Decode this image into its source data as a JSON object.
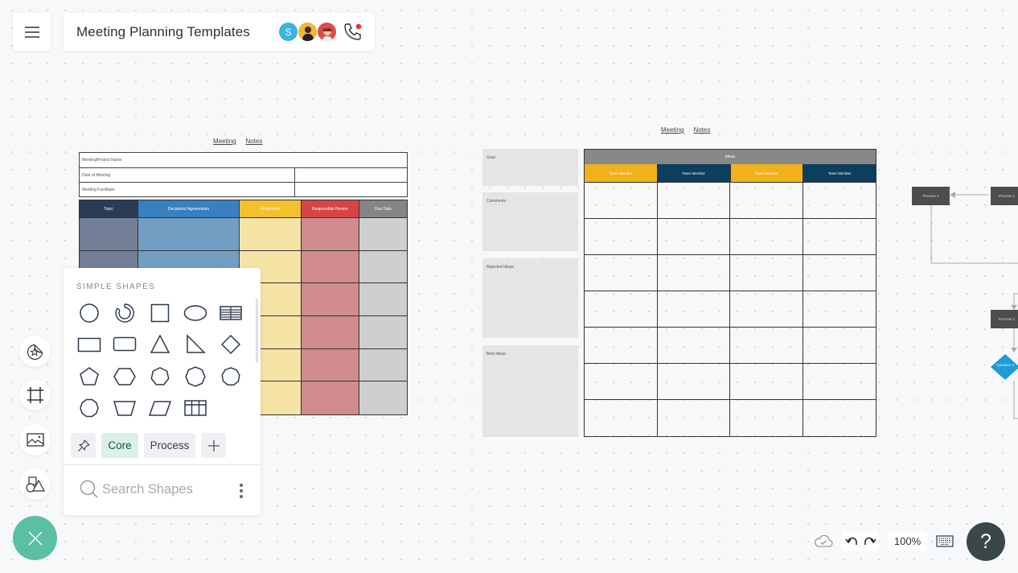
{
  "header": {
    "menu_icon": "hamburger-menu-icon",
    "title": "Meeting Planning Templates",
    "collaborators": [
      {
        "initial": "S",
        "color": "#3fb3df"
      },
      {
        "initial": "",
        "color": "#f2b632"
      },
      {
        "initial": "",
        "color": "#e24a4a"
      }
    ],
    "call_icon": "phone-icon",
    "call_indicator_color": "#e5383b"
  },
  "template_left": {
    "title_words": [
      "Meeting",
      "Notes"
    ],
    "info_rows": [
      "Meeting/Project     Name",
      "Date   of  Meeting",
      "Meeting    Facilitator"
    ],
    "columns": [
      {
        "label": "Topic",
        "header_color": "#2b3a55",
        "cell_color": "#737f96"
      },
      {
        "label": "Decisions/    Agreements",
        "header_color": "#3a7fc0",
        "cell_color": "#739ec4"
      },
      {
        "label": "Action    Item",
        "header_color": "#f2c12e",
        "cell_color": "#f6e3a6"
      },
      {
        "label": "Responsible    Person",
        "header_color": "#d64545",
        "cell_color": "#cf8b8e"
      },
      {
        "label": "Due  Date",
        "header_color": "#858585",
        "cell_color": "#cfcfcf"
      }
    ],
    "body_rows": 6
  },
  "template_right": {
    "title_words": [
      "Meeting",
      "Notes"
    ],
    "side_boxes": [
      "Goal:",
      "Comments",
      "Rejected    Ideas:",
      "Best   Ideas:"
    ],
    "ideas_header": "Ideas",
    "members": [
      {
        "label": "Team   Member",
        "color": "#f0b11c"
      },
      {
        "label": "Team   Member",
        "color": "#0c3e5e"
      },
      {
        "label": "Team   Member",
        "color": "#f0b11c"
      },
      {
        "label": "Team   Member",
        "color": "#0c3e5e"
      }
    ],
    "body_rows": 7
  },
  "flowchart": {
    "nodes": [
      "Process   2",
      "Process   1",
      "Process   3"
    ],
    "decision": "Question 4",
    "decision_color": "#1e9ad6"
  },
  "shape_panel": {
    "heading": "SIMPLE SHAPES",
    "shapes": [
      "circle",
      "donut",
      "square",
      "ellipse",
      "table",
      "rectangle",
      "rounded-rectangle",
      "triangle",
      "right-triangle",
      "diamond",
      "pentagon",
      "hexagon",
      "heptagon",
      "octagon",
      "nonagon",
      "decagon",
      "trapezoid",
      "parallelogram",
      "grid-table"
    ],
    "tabs": [
      {
        "label": "",
        "icon": "pin-icon"
      },
      {
        "label": "Core",
        "active": true
      },
      {
        "label": "Process"
      },
      {
        "label": "",
        "icon": "plus-icon"
      }
    ],
    "search_placeholder": "Search Shapes"
  },
  "tool_rail": [
    "sticker-icon",
    "frame-icon",
    "image-icon",
    "shapes-icon"
  ],
  "fab": {
    "icon": "close-icon",
    "color": "#5bbfa3"
  },
  "bottom_bar": {
    "save_status_icon": "cloud-check-icon",
    "zoom_level": "100%",
    "help_label": "?"
  }
}
